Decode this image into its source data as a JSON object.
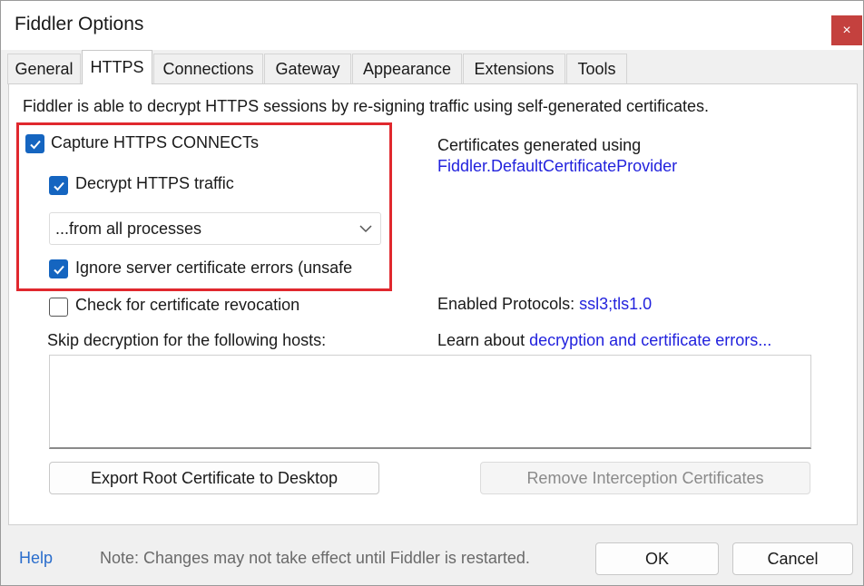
{
  "window": {
    "title": "Fiddler Options",
    "close_glyph": "×"
  },
  "tabs": [
    {
      "label": "General"
    },
    {
      "label": "HTTPS",
      "active": true
    },
    {
      "label": "Connections"
    },
    {
      "label": "Gateway"
    },
    {
      "label": "Appearance"
    },
    {
      "label": "Extensions"
    },
    {
      "label": "Tools"
    }
  ],
  "https": {
    "intro": "Fiddler is able to decrypt HTTPS sessions by re-signing traffic using self-generated certificates.",
    "capture_connects": {
      "label": "Capture HTTPS CONNECTs",
      "checked": true
    },
    "decrypt_traffic": {
      "label": "Decrypt HTTPS traffic",
      "checked": true
    },
    "process_filter": {
      "selected": "...from all processes"
    },
    "ignore_cert_errors": {
      "label": "Ignore server certificate errors (unsafe",
      "checked": true
    },
    "check_revocation": {
      "label": "Check for certificate revocation",
      "checked": false
    },
    "skip_hosts_label": "Skip decryption for the following hosts:",
    "skip_hosts_value": "",
    "certs_generated_label": "Certificates generated using",
    "cert_provider_link": "Fiddler.DefaultCertificateProvider",
    "protocols_label": "Enabled Protocols:",
    "protocols_link": "ssl3;tls1.0",
    "learn_label": "Learn about",
    "learn_link": "decryption and certificate errors...",
    "export_button": "Export Root Certificate to Desktop",
    "remove_button": "Remove Interception Certificates"
  },
  "footer": {
    "help": "Help",
    "note": "Note: Changes may not take effect until Fiddler is restarted.",
    "ok": "OK",
    "cancel": "Cancel"
  },
  "colors": {
    "checkbox_checked": "#1565c0",
    "highlight_box": "#e0282e",
    "link": "#2222dd",
    "close_button": "#c4413e"
  }
}
